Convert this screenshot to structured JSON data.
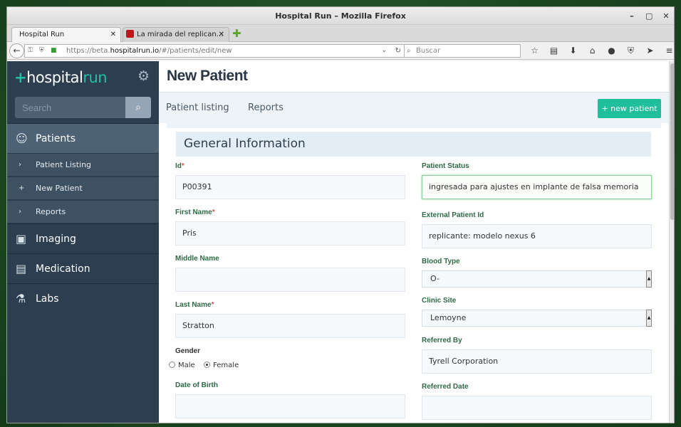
{
  "window": {
    "title": "Hospital Run – Mozilla Firefox",
    "controls": [
      "–",
      "▢",
      "✕"
    ]
  },
  "tabs": [
    {
      "label": "Hospital Run",
      "close": "✕"
    },
    {
      "label": "La mirada del replican…",
      "close": "✕"
    }
  ],
  "newtab": "✚",
  "nav": {
    "back": "←",
    "url_prefix": "https://beta.",
    "url_domain": "hospitalrun.io",
    "url_path": "/#/patients/edit/new",
    "search_placeholder": "Buscar",
    "tool_icons": [
      "☆",
      "▤",
      "⬇",
      "⌂",
      "●",
      "⛨",
      "➤",
      "≡"
    ]
  },
  "sidebar": {
    "logo_plus": "+",
    "logo_hospital": "hospital",
    "logo_run": "run",
    "search_placeholder": "Search",
    "items": [
      {
        "label": "Patients",
        "icon": "patients-icon"
      },
      {
        "label": "Imaging",
        "icon": "camera-icon"
      },
      {
        "label": "Medication",
        "icon": "document-icon"
      },
      {
        "label": "Labs",
        "icon": "microscope-icon"
      }
    ],
    "subitems": [
      {
        "label": "Patient Listing",
        "marker": "›"
      },
      {
        "label": "New Patient",
        "marker": "+"
      },
      {
        "label": "Reports",
        "marker": "›"
      }
    ]
  },
  "main": {
    "title": "New Patient",
    "links": [
      "Patient listing",
      "Reports"
    ],
    "new_button": "+ new patient",
    "section": "General Information",
    "fields": {
      "id": {
        "label": "Id",
        "value": "P00391"
      },
      "first_name": {
        "label": "First Name",
        "value": "Pris"
      },
      "middle_name": {
        "label": "Middle Name",
        "value": ""
      },
      "last_name": {
        "label": "Last Name",
        "value": "Stratton"
      },
      "gender": {
        "label": "Gender",
        "options": [
          "Male",
          "Female"
        ],
        "selected": "Female"
      },
      "dob": {
        "label": "Date of Birth",
        "value": ""
      },
      "patient_status": {
        "label": "Patient Status",
        "value": "ingresada para ajustes en implante de falsa memoria"
      },
      "external_id": {
        "label": "External Patient Id",
        "value": "replicante: modelo nexus 6"
      },
      "blood_type": {
        "label": "Blood Type",
        "value": "O-"
      },
      "clinic_site": {
        "label": "Clinic Site",
        "value": "Lemoyne"
      },
      "referred_by": {
        "label": "Referred By",
        "value": "Tyrell Corporation"
      },
      "referred_date": {
        "label": "Referred Date",
        "value": ""
      }
    },
    "required_mark": "*"
  },
  "colors": {
    "sidebar": "#2d3e50",
    "accent": "#1fbf9c",
    "label": "#2c6b44"
  }
}
